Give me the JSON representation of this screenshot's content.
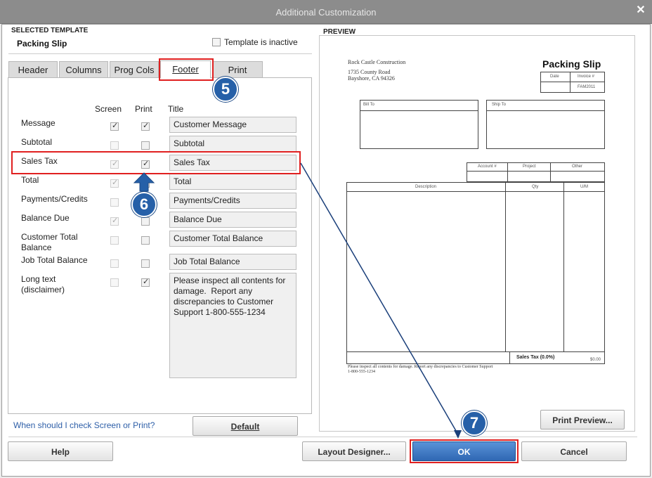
{
  "window": {
    "title": "Additional Customization"
  },
  "selected_template": {
    "heading": "SELECTED TEMPLATE",
    "name": "Packing Slip",
    "inactive_label": "Template is inactive"
  },
  "tabs": [
    {
      "label": "Header"
    },
    {
      "label": "Columns"
    },
    {
      "label": "Prog Cols"
    },
    {
      "label": "Footer"
    },
    {
      "label": "Print"
    }
  ],
  "footer": {
    "col_screen": "Screen",
    "col_print": "Print",
    "col_title": "Title",
    "rows": [
      {
        "label": "Message",
        "screen": true,
        "screen_enabled": true,
        "print": true,
        "title": "Customer Message"
      },
      {
        "label": "Subtotal",
        "screen": false,
        "screen_enabled": false,
        "print": false,
        "title": "Subtotal"
      },
      {
        "label": "Sales Tax",
        "screen": true,
        "screen_enabled": false,
        "print": true,
        "title": "Sales Tax"
      },
      {
        "label": "Total",
        "screen": true,
        "screen_enabled": false,
        "print": false,
        "title": "Total"
      },
      {
        "label": "Payments/Credits",
        "screen": false,
        "screen_enabled": false,
        "print": false,
        "title": "Payments/Credits"
      },
      {
        "label": "Balance Due",
        "screen": true,
        "screen_enabled": false,
        "print": false,
        "title": "Balance Due"
      },
      {
        "label": "Customer Total Balance",
        "screen": false,
        "screen_enabled": false,
        "print": false,
        "title": "Customer Total Balance"
      },
      {
        "label": "Job Total Balance",
        "screen": false,
        "screen_enabled": false,
        "print": false,
        "title": "Job Total Balance"
      },
      {
        "label": "Long text (disclaimer)",
        "screen": false,
        "screen_enabled": false,
        "print": true,
        "title": "Please inspect all contents for damage.  Report any discrepancies to Customer Support 1-800-555-1234"
      }
    ],
    "help_link": "When should I check Screen or Print?",
    "default_button": "Default"
  },
  "preview": {
    "heading": "PREVIEW",
    "company_name": "Rock Castle Construction",
    "company_addr1": "1735 County Road",
    "company_addr2": "Bayshore, CA 94326",
    "doc_title": "Packing Slip",
    "date_label": "Date",
    "invoice_label": "Invoice #",
    "invoice_value": "FAM2011",
    "bill_to": "Bill To",
    "ship_to": "Ship To",
    "account_label": "Account #",
    "project_label": "Project",
    "other_label": "Other",
    "description_label": "Description",
    "qty_label": "Qty",
    "um_label": "U/M",
    "sales_tax_line": "Sales Tax  (0.0%)",
    "sales_tax_value": "$0.00",
    "footer_text_1": "Please inspect all contents for damage.  Report any discrepancies to Customer Support",
    "footer_text_2": "1-800-555-1234",
    "print_preview_button": "Print Preview..."
  },
  "buttons": {
    "help": "Help",
    "layout_designer": "Layout Designer...",
    "ok": "OK",
    "cancel": "Cancel"
  },
  "annotations": {
    "step5": "5",
    "step6": "6",
    "step7": "7"
  },
  "colors": {
    "highlight": "#e02020",
    "badge": "#2660a8",
    "ok_button": "#3d78c4"
  }
}
